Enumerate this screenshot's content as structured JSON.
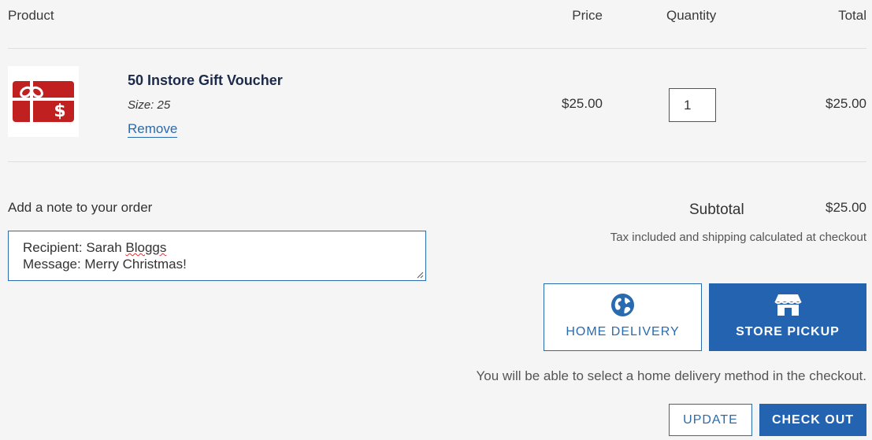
{
  "table": {
    "headers": {
      "product": "Product",
      "price": "Price",
      "quantity": "Quantity",
      "total": "Total"
    }
  },
  "item": {
    "image_icon": "gift-card-icon",
    "name": "50 Instore Gift Voucher",
    "size": "Size: 25",
    "remove_label": "Remove",
    "price": "$25.00",
    "quantity": "1",
    "total": "$25.00"
  },
  "note": {
    "label": "Add a note to your order",
    "line1_prefix": "Recipient: Sarah ",
    "line1_misspelled": "Bloggs",
    "line2": "Message: Merry Christmas!"
  },
  "summary": {
    "subtotal_label": "Subtotal",
    "subtotal_value": "$25.00",
    "tax_note": "Tax included and shipping calculated at checkout"
  },
  "delivery": {
    "options": [
      {
        "label": "HOME DELIVERY",
        "icon": "globe-icon",
        "selected": false
      },
      {
        "label": "STORE PICKUP",
        "icon": "storefront-icon",
        "selected": true
      }
    ],
    "info": "You will be able to select a home delivery method in the checkout."
  },
  "actions": {
    "update_label": "UPDATE",
    "checkout_label": "CHECK OUT"
  },
  "colors": {
    "accent": "#2463b0",
    "voucher_red": "#c0201f",
    "background": "#f5f5f5"
  }
}
